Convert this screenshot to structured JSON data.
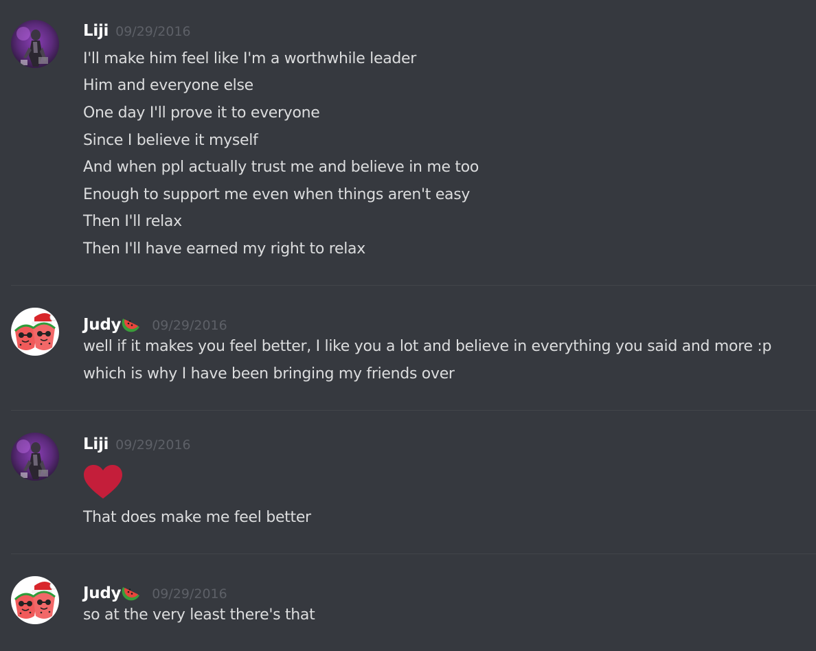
{
  "messages": [
    {
      "author": "Liji",
      "timestamp": "09/29/2016",
      "avatar": "liji-avatar",
      "lines": [
        "I'll make him feel like I'm a worthwhile leader",
        "Him and everyone else",
        "One day I'll prove it to everyone",
        "Since I believe it myself",
        "And when ppl actually trust me and believe in me too",
        "Enough to support me even when things aren't easy",
        "Then I'll relax",
        "Then I'll have earned my right to relax"
      ]
    },
    {
      "author": "Judy",
      "author_emoji": "watermelon-icon",
      "timestamp": "09/29/2016",
      "avatar": "judy-avatar",
      "lines": [
        "well if it makes you feel better, I like you a lot and believe in everything you said and more :p",
        "which is why I have been bringing my friends over"
      ]
    },
    {
      "author": "Liji",
      "timestamp": "09/29/2016",
      "avatar": "liji-avatar",
      "emoji": "heart-icon",
      "lines": [
        "That does make me feel better"
      ]
    },
    {
      "author": "Judy",
      "author_emoji": "watermelon-icon",
      "timestamp": "09/29/2016",
      "avatar": "judy-avatar",
      "lines": [
        "so at the very least there's that"
      ]
    }
  ],
  "colors": {
    "background": "#36393f",
    "username": "#ffffff",
    "timestamp": "#5d6067",
    "message_text": "#dcddde",
    "divider": "#42454a",
    "heart": "#c41e3a"
  }
}
